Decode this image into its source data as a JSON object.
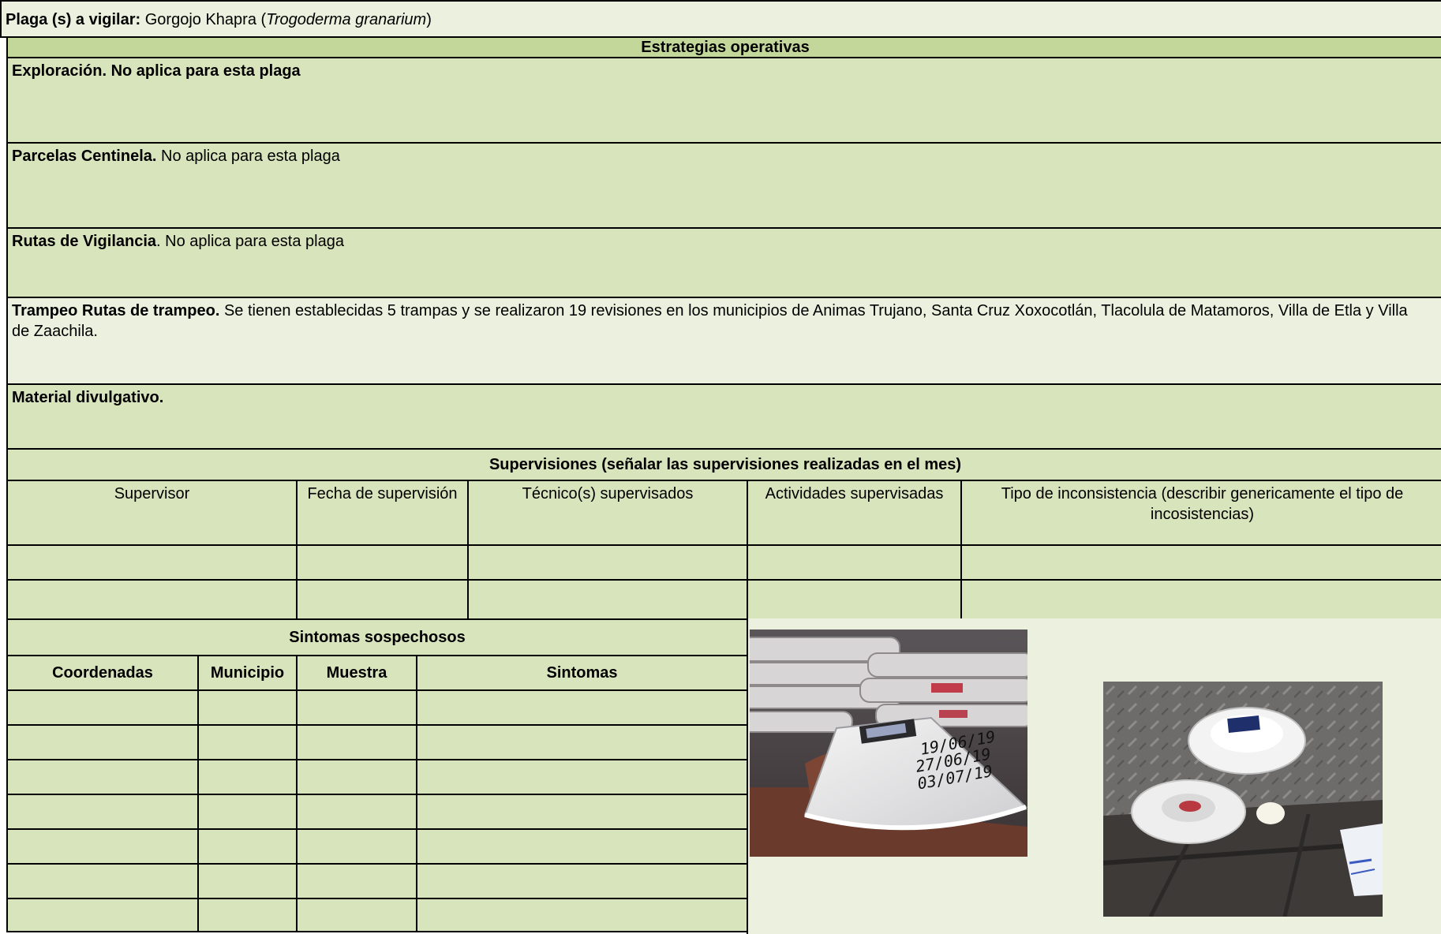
{
  "header": {
    "plaga_label": "Plaga (s) a vigilar:",
    "plaga_common": "Gorgojo Khapra (",
    "plaga_scientific": "Trogoderma granarium",
    "plaga_close": ")"
  },
  "estrategias": {
    "title": "Estrategias operativas",
    "exploracion": {
      "label": "Exploración. No aplica para esta plaga",
      "text": ""
    },
    "centinela": {
      "label": "Parcelas Centinela.",
      "text": " No aplica para esta plaga"
    },
    "rutas": {
      "label": "Rutas de Vigilancia",
      "text": ". No aplica para esta plaga"
    },
    "trampeo": {
      "label": "Trampeo Rutas de trampeo.",
      "text": " Se tienen establecidas 5 trampas y se realizaron 19 revisiones en los municipios de Animas Trujano, Santa Cruz Xoxocotlán, Tlacolula de Matamoros, Villa de Etla y Villa de Zaachila."
    },
    "material": {
      "label": "Material  divulgativo."
    }
  },
  "supervisiones": {
    "title": "Supervisiones (señalar las supervisiones realizadas en el mes)",
    "columns": [
      "Supervisor",
      "Fecha de supervisión",
      "Técnico(s) supervisados",
      "Actividades supervisadas",
      "Tipo de inconsistencia (describir genericamente el tipo de incosistencias)"
    ]
  },
  "sintomas": {
    "title": "Sintomas sospechosos",
    "columns": [
      "Coordenadas",
      "Municipio",
      "Muestra",
      "Sintomas"
    ]
  },
  "photos": {
    "photo1_text": "19/06/19\n27/06/19\n03/07/19"
  }
}
